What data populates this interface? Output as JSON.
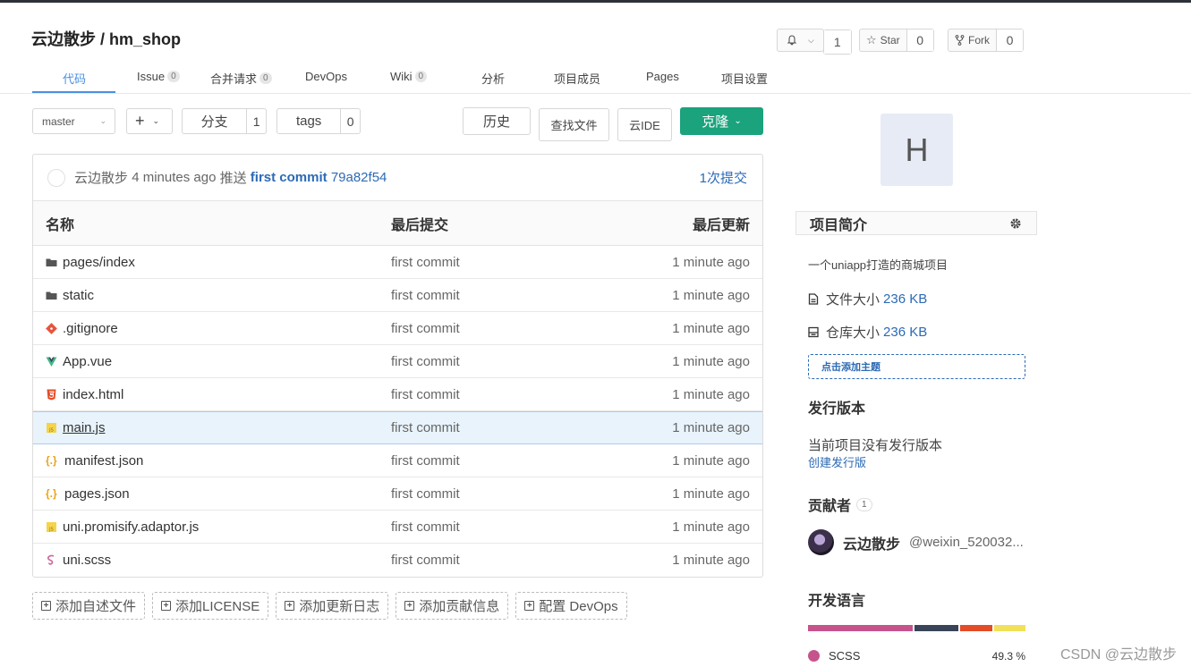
{
  "repo": {
    "owner": "云边散步",
    "sep": " / ",
    "name": "hm_shop"
  },
  "watch": {
    "count": "1"
  },
  "star": {
    "label": "Star",
    "count": "0"
  },
  "fork": {
    "label": "Fork",
    "count": "0"
  },
  "tabs": [
    {
      "label": "代码",
      "count": null,
      "active": true
    },
    {
      "label": "Issue",
      "count": "0"
    },
    {
      "label": "合并请求",
      "count": "0"
    },
    {
      "label": "DevOps",
      "count": null
    },
    {
      "label": "Wiki",
      "count": "0"
    },
    {
      "label": "分析",
      "count": null
    },
    {
      "label": "项目成员",
      "count": null
    },
    {
      "label": "Pages",
      "count": null
    },
    {
      "label": "项目设置",
      "count": null
    }
  ],
  "toolbar": {
    "branch": "master",
    "plus": "+",
    "branches_label": "分支",
    "branches_count": "1",
    "tags_label": "tags",
    "tags_count": "0",
    "history": "历史",
    "find_file": "查找文件",
    "cloud_ide": "云IDE",
    "clone": "克隆"
  },
  "last_commit": {
    "author": "云边散步",
    "time": "4 minutes ago",
    "action": "推送",
    "message": "first commit",
    "hash": "79a82f54",
    "commits_link": "1次提交"
  },
  "table": {
    "headers": {
      "name": "名称",
      "commit": "最后提交",
      "updated": "最后更新"
    },
    "rows": [
      {
        "name": "pages/index",
        "icon": "folder-icon",
        "commit": "first commit",
        "updated": "1 minute ago"
      },
      {
        "name": "static",
        "icon": "folder-icon",
        "commit": "first commit",
        "updated": "1 minute ago"
      },
      {
        "name": ".gitignore",
        "icon": "git-icon",
        "commit": "first commit",
        "updated": "1 minute ago"
      },
      {
        "name": "App.vue",
        "icon": "vue-icon",
        "commit": "first commit",
        "updated": "1 minute ago"
      },
      {
        "name": "index.html",
        "icon": "html5-icon",
        "commit": "first commit",
        "updated": "1 minute ago"
      },
      {
        "name": "main.js",
        "icon": "js-icon",
        "commit": "first commit",
        "updated": "1 minute ago",
        "highlighted": true
      },
      {
        "name": "manifest.json",
        "icon": "json-icon",
        "commit": "first commit",
        "updated": "1 minute ago"
      },
      {
        "name": "pages.json",
        "icon": "json-icon",
        "commit": "first commit",
        "updated": "1 minute ago"
      },
      {
        "name": "uni.promisify.adaptor.js",
        "icon": "js-icon",
        "commit": "first commit",
        "updated": "1 minute ago"
      },
      {
        "name": "uni.scss",
        "icon": "sass-icon",
        "commit": "first commit",
        "updated": "1 minute ago"
      }
    ]
  },
  "add_buttons": [
    "添加自述文件",
    "添加LICENSE",
    "添加更新日志",
    "添加贡献信息",
    "配置 DevOps"
  ],
  "sidebar": {
    "avatar_letter": "H",
    "intro_title": "项目简介",
    "description": "一个uniapp打造的商城项目",
    "file_size_label": "文件大小",
    "file_size": "236 KB",
    "repo_size_label": "仓库大小",
    "repo_size": "236 KB",
    "add_topic": "点击添加主题",
    "releases_title": "发行版本",
    "no_release": "当前项目没有发行版本",
    "create_release": "创建发行版",
    "contributors_title": "贡献者",
    "contributors_count": "1",
    "contributor_name": "云边散步",
    "contributor_handle": "@weixin_520032...",
    "languages_title": "开发语言",
    "languages": [
      {
        "name": "SCSS",
        "percent": "49.3 %",
        "value": 49.3,
        "color": "#c6538c"
      },
      {
        "name": "",
        "value": 20.5,
        "color": "#384457"
      },
      {
        "name": "",
        "value": 15.0,
        "color": "#e34c26"
      },
      {
        "name": "",
        "value": 15.2,
        "color": "#f1e05a"
      }
    ]
  },
  "watermark": "CSDN @云边散步",
  "colors": {
    "accent": "#4a90e2",
    "clone": "#1aa37c",
    "link": "#2c6ab5"
  }
}
